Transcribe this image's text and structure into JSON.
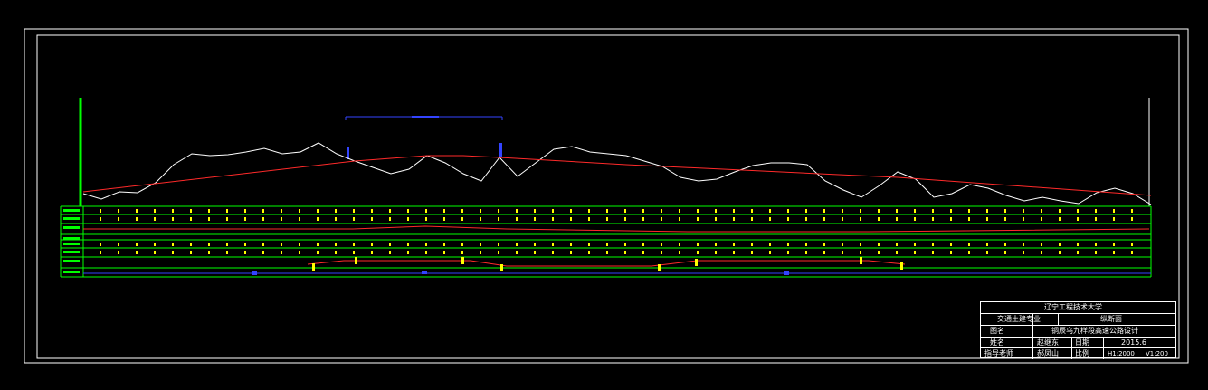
{
  "title_block": {
    "school": "辽宁工程技术大学",
    "major": "交通土建专业",
    "drawing_type": "纵断面",
    "label_name": "图名",
    "drawing_name": "铜辰乌九样段高速公路设计",
    "label_student": "姓名",
    "student": "赵继东",
    "label_date": "日期",
    "date": "2015.6",
    "label_advisor": "指导老师",
    "advisor": "郝凤山",
    "label_scale": "比例",
    "scale_h": "H1:2000",
    "scale_v": "V1:200"
  },
  "colors": {
    "frame": "#ffffff",
    "ground_line": "#ffffff",
    "design_line": "#ff2a2a",
    "band_border": "#00ff00",
    "band_mark": "#ffff00",
    "curve_mark": "#3344ff"
  },
  "chart_data": {
    "type": "line",
    "series": [
      {
        "values": [
          [
            0,
            214
          ],
          [
            20,
            220
          ],
          [
            40,
            212
          ],
          [
            60,
            213
          ],
          [
            80,
            202
          ],
          [
            100,
            182
          ],
          [
            120,
            170
          ],
          [
            140,
            172
          ],
          [
            160,
            171
          ],
          [
            180,
            168
          ],
          [
            200,
            164
          ],
          [
            220,
            170
          ],
          [
            240,
            168
          ],
          [
            260,
            158
          ],
          [
            280,
            170
          ],
          [
            300,
            178
          ],
          [
            320,
            185
          ],
          [
            340,
            192
          ],
          [
            360,
            187
          ],
          [
            380,
            172
          ],
          [
            400,
            180
          ],
          [
            420,
            192
          ],
          [
            440,
            200
          ],
          [
            460,
            174
          ],
          [
            480,
            195
          ],
          [
            500,
            180
          ],
          [
            520,
            165
          ],
          [
            540,
            162
          ],
          [
            560,
            168
          ],
          [
            580,
            170
          ],
          [
            600,
            172
          ],
          [
            620,
            178
          ],
          [
            640,
            184
          ],
          [
            660,
            196
          ],
          [
            680,
            200
          ],
          [
            700,
            198
          ],
          [
            720,
            190
          ],
          [
            740,
            183
          ],
          [
            760,
            180
          ],
          [
            780,
            180
          ],
          [
            800,
            182
          ],
          [
            820,
            200
          ],
          [
            840,
            210
          ],
          [
            860,
            218
          ],
          [
            880,
            205
          ],
          [
            900,
            190
          ],
          [
            920,
            198
          ],
          [
            940,
            218
          ],
          [
            960,
            214
          ],
          [
            980,
            204
          ],
          [
            1000,
            208
          ],
          [
            1020,
            216
          ],
          [
            1040,
            222
          ],
          [
            1060,
            218
          ],
          [
            1080,
            222
          ],
          [
            1100,
            225
          ],
          [
            1120,
            213
          ],
          [
            1140,
            208
          ],
          [
            1160,
            214
          ],
          [
            1180,
            226
          ]
        ]
      },
      {
        "values": [
          [
            0,
            212
          ],
          [
            300,
            178
          ],
          [
            380,
            172
          ],
          [
            420,
            172
          ],
          [
            460,
            174
          ],
          [
            600,
            182
          ],
          [
            900,
            196
          ],
          [
            1180,
            216
          ]
        ]
      }
    ]
  }
}
